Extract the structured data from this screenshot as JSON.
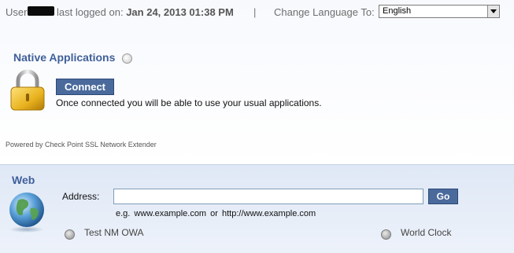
{
  "header": {
    "user_label": "User:",
    "last_logged_prefix": "last logged on:",
    "last_logged_value": "Jan 24, 2013 01:38 PM",
    "separator": "|",
    "change_language_label": "Change Language To:",
    "language_selected": "English"
  },
  "native_applications": {
    "title": "Native Applications",
    "connect_label": "Connect",
    "description": "Once connected you will be able to use your usual applications.",
    "powered_by": "Powered by Check Point SSL Network Extender"
  },
  "web": {
    "title": "Web",
    "address_label": "Address:",
    "address_value": "",
    "go_label": "Go",
    "example_hint": "e.g.  www.example.com  or  http://www.example.com",
    "bookmarks": [
      {
        "label": "Test NM OWA"
      },
      {
        "label": "World Clock"
      }
    ]
  },
  "colors": {
    "accent": "#4a6a9c",
    "title_blue": "#3f5f9a"
  }
}
